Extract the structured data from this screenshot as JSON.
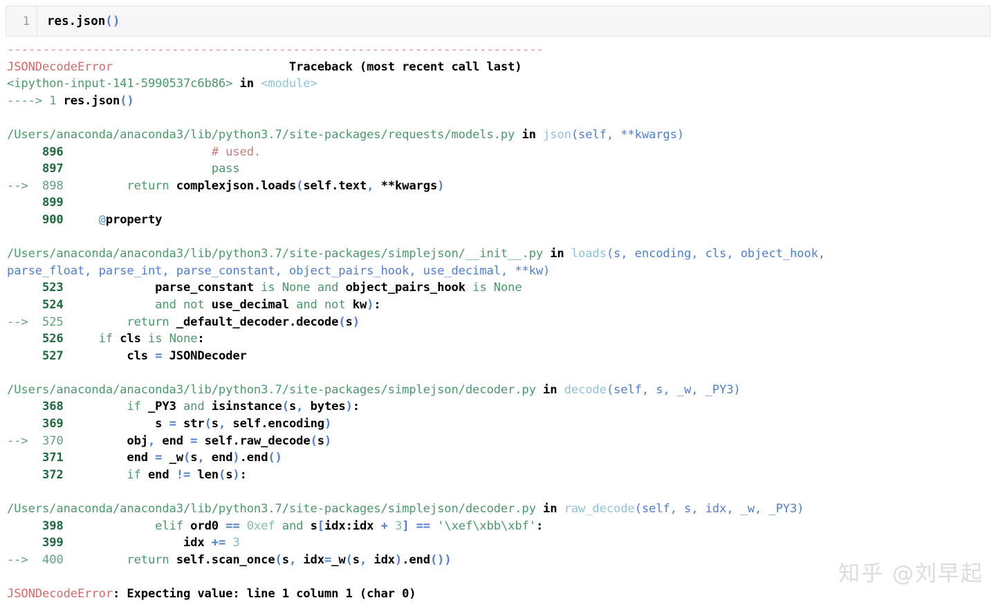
{
  "cell": {
    "line_number": "1",
    "code": "res.json()",
    "code_tokens": [
      {
        "t": "res.json",
        "c": "plain"
      },
      {
        "t": "()",
        "c": "paren-green"
      }
    ]
  },
  "traceback": {
    "separator": "---------------------------------------------------------------------------",
    "header_error": "JSONDecodeError",
    "header_right": "Traceback (most recent call last)",
    "origin_frame": "<ipython-input-141-5990537c6b86> in <module>",
    "origin_arrow": "----> 1 res.json()",
    "final_error_name": "JSONDecodeError",
    "final_error_message": ": Expecting value: line 1 column 1 (char 0)",
    "frames": [
      {
        "path": "/Users/anaconda/anaconda3/lib/python3.7/site-packages/requests/models.py",
        "in": " in ",
        "func": "json",
        "signature": "(self, **kwargs)",
        "signature_cont": "",
        "lines": [
          {
            "arrow": "",
            "num": "896",
            "code": "                    # used."
          },
          {
            "arrow": "",
            "num": "897",
            "code": "                    pass"
          },
          {
            "arrow": "-->",
            "num": "898",
            "code": "        return complexjson.loads(self.text, **kwargs)"
          },
          {
            "arrow": "",
            "num": "899",
            "code": ""
          },
          {
            "arrow": "",
            "num": "900",
            "code": "    @property"
          }
        ]
      },
      {
        "path": "/Users/anaconda/anaconda3/lib/python3.7/site-packages/simplejson/__init__.py",
        "in": " in ",
        "func": "loads",
        "signature": "(s, encoding, cls, object_hook,",
        "signature_cont": "parse_float, parse_int, parse_constant, object_pairs_hook, use_decimal, **kw)",
        "lines": [
          {
            "arrow": "",
            "num": "523",
            "code": "            parse_constant is None and object_pairs_hook is None"
          },
          {
            "arrow": "",
            "num": "524",
            "code": "            and not use_decimal and not kw):"
          },
          {
            "arrow": "-->",
            "num": "525",
            "code": "        return _default_decoder.decode(s)"
          },
          {
            "arrow": "",
            "num": "526",
            "code": "    if cls is None:"
          },
          {
            "arrow": "",
            "num": "527",
            "code": "        cls = JSONDecoder"
          }
        ]
      },
      {
        "path": "/Users/anaconda/anaconda3/lib/python3.7/site-packages/simplejson/decoder.py",
        "in": " in ",
        "func": "decode",
        "signature": "(self, s, _w, _PY3)",
        "signature_cont": "",
        "lines": [
          {
            "arrow": "",
            "num": "368",
            "code": "        if _PY3 and isinstance(s, bytes):"
          },
          {
            "arrow": "",
            "num": "369",
            "code": "            s = str(s, self.encoding)"
          },
          {
            "arrow": "-->",
            "num": "370",
            "code": "        obj, end = self.raw_decode(s)"
          },
          {
            "arrow": "",
            "num": "371",
            "code": "        end = _w(s, end).end()"
          },
          {
            "arrow": "",
            "num": "372",
            "code": "        if end != len(s):"
          }
        ]
      },
      {
        "path": "/Users/anaconda/anaconda3/lib/python3.7/site-packages/simplejson/decoder.py",
        "in": " in ",
        "func": "raw_decode",
        "signature": "(self, s, idx, _w, _PY3)",
        "signature_cont": "",
        "lines": [
          {
            "arrow": "",
            "num": "398",
            "code": "            elif ord0 == 0xef and s[idx:idx + 3] == '\\xef\\xbb\\xbf':"
          },
          {
            "arrow": "",
            "num": "399",
            "code": "                idx += 3"
          },
          {
            "arrow": "-->",
            "num": "400",
            "code": "        return self.scan_once(s, idx=_w(s, idx).end())"
          }
        ]
      }
    ]
  },
  "watermark": {
    "text": "知乎 @刘早起"
  },
  "colors": {
    "error_red": "#d46a6a",
    "path_green": "#4a9a6a",
    "func_blue": "#8fc4d8",
    "arg_blue": "#4f7fd1",
    "linenum_green": "#1c6b3c",
    "keyword_green": "#4a9a6a",
    "cell_bg": "#f7f7f7",
    "cell_border": "#e3e3e3",
    "page_bg": "#ffffff"
  }
}
